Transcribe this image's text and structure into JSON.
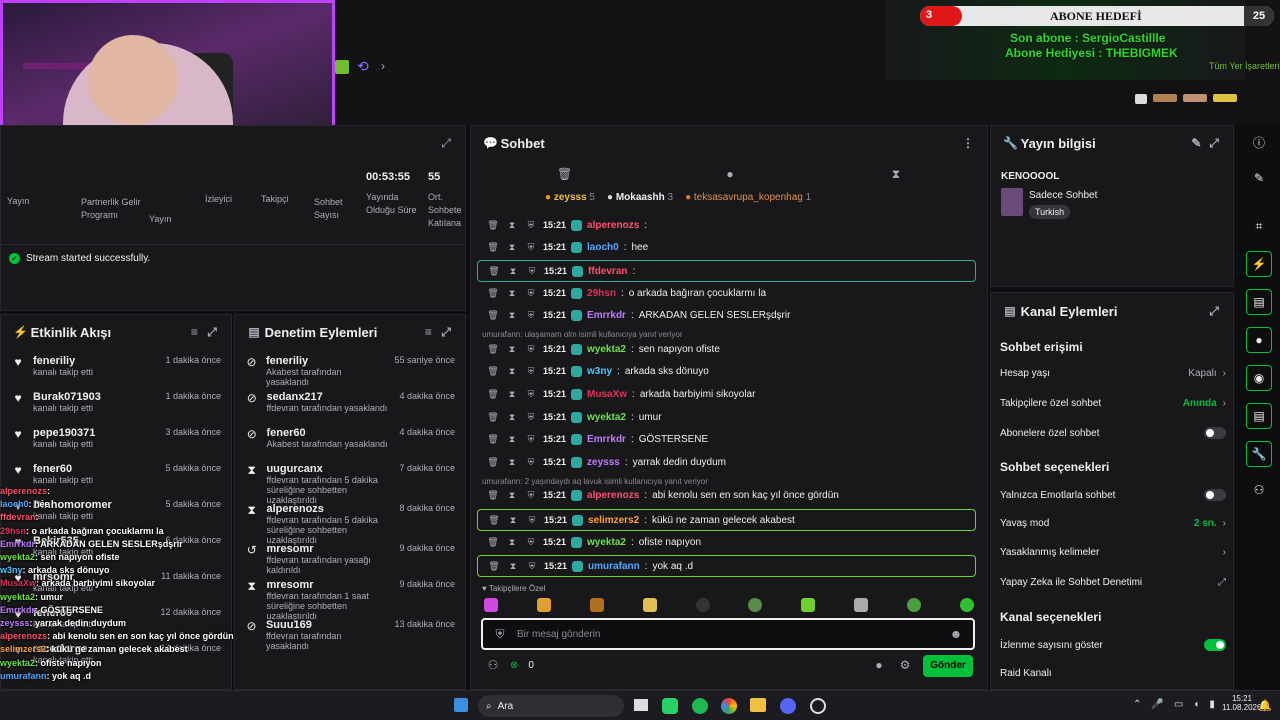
{
  "overlay": {
    "abone_hedefi": "ABONE HEDEFİ",
    "goal_current": "3",
    "goal_target": "25",
    "son_abone": "Son abone : SergioCastillle",
    "abone_hediyesi": "Abone Hediyesi : THEBIGMEK",
    "bookmarks": "Tüm Yer İşaretleri"
  },
  "stats": {
    "labels": [
      "Yayın",
      "Partnerlik Gelir Programı",
      "Yayın",
      "İzleyici",
      "Takipçi",
      "Sohbet Sayısı"
    ],
    "duration_value": "00:53:55",
    "duration_label": "Yayında Olduğu Süre",
    "avg_value": "55",
    "avg_label": "Ort. Sohbete Katılana"
  },
  "status": {
    "text": "Stream started successfully."
  },
  "activity": {
    "title": "Etkinlik Akışı",
    "items": [
      {
        "name": "feneriliy",
        "sub": "kanalı takip etti",
        "time": "1 dakika önce"
      },
      {
        "name": "Burak071903",
        "sub": "kanalı takip etti",
        "time": "1 dakika önce"
      },
      {
        "name": "pepe190371",
        "sub": "kanalı takip etti",
        "time": "3 dakika önce"
      },
      {
        "name": "fener60",
        "sub": "kanalı takip etti",
        "time": "5 dakika önce"
      },
      {
        "name": "Dinhomoromer",
        "sub": "kanalı takip etti",
        "time": "5 dakika önce"
      },
      {
        "name": "Bekir535",
        "sub": "kanalı takip etti",
        "time": "6 dakika önce"
      },
      {
        "name": "mrsomr",
        "sub": "kanalı takip etti",
        "time": "11 dakika önce"
      },
      {
        "name": "fener00",
        "sub": "kanalı takip etti",
        "time": "12 dakika önce"
      },
      {
        "name": "racerforge",
        "sub": "kanalı takip etti",
        "time": "14 dakika önce"
      }
    ]
  },
  "moderation": {
    "title": "Denetim Eylemleri",
    "items": [
      {
        "name": "feneriliy",
        "sub": "Akabest tarafından yasaklandı",
        "time": "55 saniye önce"
      },
      {
        "name": "sedanx217",
        "sub": "ffdevran tarafından yasaklandı",
        "time": "4 dakika önce"
      },
      {
        "name": "fener60",
        "sub": "Akabest tarafından yasaklandı",
        "time": "4 dakika önce"
      },
      {
        "name": "uugurcanx",
        "sub": "ffdevran tarafından 5 dakika süreliğine sohbetten uzaklaştırıldı",
        "time": "7 dakika önce"
      },
      {
        "name": "alperenozs",
        "sub": "ffdevran tarafından 5 dakika süreliğine sohbetten uzaklaştırıldı",
        "time": "8 dakika önce"
      },
      {
        "name": "mresomr",
        "sub": "ffdevran tarafından yasağı kaldırıldı",
        "time": "9 dakika önce"
      },
      {
        "name": "mresomr",
        "sub": "ffdevran tarafından 1 saat süreliğine sohbetten uzaklaştırıldı",
        "time": "9 dakika önce"
      },
      {
        "name": "Suuu169",
        "sub": "ffdevran tarafından yasaklandı",
        "time": "13 dakika önce"
      }
    ]
  },
  "chat": {
    "title": "Sohbet",
    "top_chatters": [
      {
        "name": "zeysss",
        "count": "5"
      },
      {
        "name": "Mokaashh",
        "count": "3"
      },
      {
        "name": "teksasavrupa_kopenhag",
        "count": "1"
      }
    ],
    "messages": [
      {
        "time": "15:21",
        "user": "alperenozs",
        "color": "#ff4f6d",
        "text": ""
      },
      {
        "time": "15:21",
        "user": "laoch0",
        "color": "#4fa8ff",
        "text": "hee"
      },
      {
        "time": "15:21",
        "user": "ffdevran",
        "color": "#ff4f6d",
        "text": ""
      },
      {
        "time": "15:21",
        "user": "29hsn",
        "color": "#e0305a",
        "text": "o arkada bağıran çocuklarmı la"
      },
      {
        "time": "15:21",
        "user": "Emrrkdr",
        "color": "#c07aff",
        "text": "ARKADAN GELEN SESLERşdşrir"
      },
      {
        "time": "15:21",
        "user": "wyekta2",
        "color": "#6fe04a",
        "text": "sen napıyon ofiste"
      },
      {
        "time": "15:21",
        "user": "w3ny",
        "color": "#4fc8ff",
        "text": "arkada sks dönuyo"
      },
      {
        "time": "15:21",
        "user": "MusaXw",
        "color": "#e0305a",
        "text": "arkada barbiyimi sikoyolar"
      },
      {
        "time": "15:21",
        "user": "wyekta2",
        "color": "#6fe04a",
        "text": "umur"
      },
      {
        "time": "15:21",
        "user": "Emrrkdr",
        "color": "#c07aff",
        "text": "GÖSTERSENE"
      },
      {
        "time": "15:21",
        "user": "zeysss",
        "color": "#c07aff",
        "text": "yarrak dedin duydum"
      },
      {
        "time": "15:21",
        "user": "alperenozs",
        "color": "#ff4f6d",
        "text": "abi kenolu sen en son kaç yıl önce gördün"
      },
      {
        "time": "15:21",
        "user": "selimzers2",
        "color": "#ff9f3a",
        "text": "kükü ne zaman gelecek akabest"
      },
      {
        "time": "15:21",
        "user": "wyekta2",
        "color": "#6fe04a",
        "text": "ofiste napıyon"
      },
      {
        "time": "15:21",
        "user": "umurafann",
        "color": "#4fa8ff",
        "text": "yok aq .d"
      }
    ],
    "reply1": "umurafann: ulaşamam olm isimli kullanıcıya yanıt veriyor",
    "reply2": "umurafann: 2 yaşındaydı aq lavuk isimli kullanıcıya yanıt veriyor",
    "emote_section": "Takipçilere Özel",
    "input_placeholder": "Bir mesaj gönderin",
    "count": "0",
    "send": "Gönder"
  },
  "stream_info": {
    "title": "Yayın bilgisi",
    "username": "KENOOOOL",
    "category": "Sadece Sohbet",
    "tag": "Turkish"
  },
  "channel_actions": {
    "title": "Kanal Eylemleri",
    "chat_access": "Sohbet erişimi",
    "age_label": "Hesap yaşı",
    "age_value": "Kapalı",
    "followers_label": "Takipçilere özel sohbet",
    "followers_value": "Anında",
    "subs_label": "Abonelere özel sohbet",
    "chat_options": "Sohbet seçenekleri",
    "emote_only": "Yalnızca Emotlarla sohbet",
    "slow_label": "Yavaş mod",
    "slow_value": "2 sn.",
    "banned_words": "Yasaklanmış kelimeler",
    "ai_mod": "Yapay Zeka ile Sohbet Denetimi",
    "channel_options": "Kanal seçenekleri",
    "viewer_count": "İzlenme sayısını göster",
    "raid": "Raid Kanalı"
  },
  "taskbar": {
    "search": "Ara",
    "time": "15:21",
    "date": "11.08.2026"
  },
  "overlay_chat": [
    {
      "user": "alperenozs",
      "color": "#ff4f6d",
      "text": ""
    },
    {
      "user": "laoch0",
      "color": "#4fa8ff",
      "text": "hee"
    },
    {
      "user": "ffdevran",
      "color": "#ff4f6d",
      "text": ""
    },
    {
      "user": "29hsn",
      "color": "#e0305a",
      "text": "o arkada bağıran çocuklarmı la"
    },
    {
      "user": "Emrrkdr",
      "color": "#c07aff",
      "text": "ARKADAN GELEN SESLERşdşrir"
    },
    {
      "user": "wyekta2",
      "color": "#6fe04a",
      "text": "sen napıyon ofiste"
    },
    {
      "user": "w3ny",
      "color": "#4fc8ff",
      "text": "arkada sks dönuyo"
    },
    {
      "user": "MusaXw",
      "color": "#e0305a",
      "text": "arkada barbiyimi sikoyolar"
    },
    {
      "user": "wyekta2",
      "color": "#6fe04a",
      "text": "umur"
    },
    {
      "user": "Emrrkdr",
      "color": "#c07aff",
      "text": "GÖSTERSENE"
    },
    {
      "user": "zeysss",
      "color": "#c07aff",
      "text": "yarrak dedin duydum"
    },
    {
      "user": "alperenozs",
      "color": "#ff4f6d",
      "text": "abi kenolu sen en son kaç yıl önce gördün"
    },
    {
      "user": "selimzers2",
      "color": "#ff9f3a",
      "text": "kükü ne zaman gelecek akabest"
    },
    {
      "user": "wyekta2",
      "color": "#6fe04a",
      "text": "ofiste napıyon"
    },
    {
      "user": "umurafann",
      "color": "#4fa8ff",
      "text": "yok aq .d"
    }
  ]
}
